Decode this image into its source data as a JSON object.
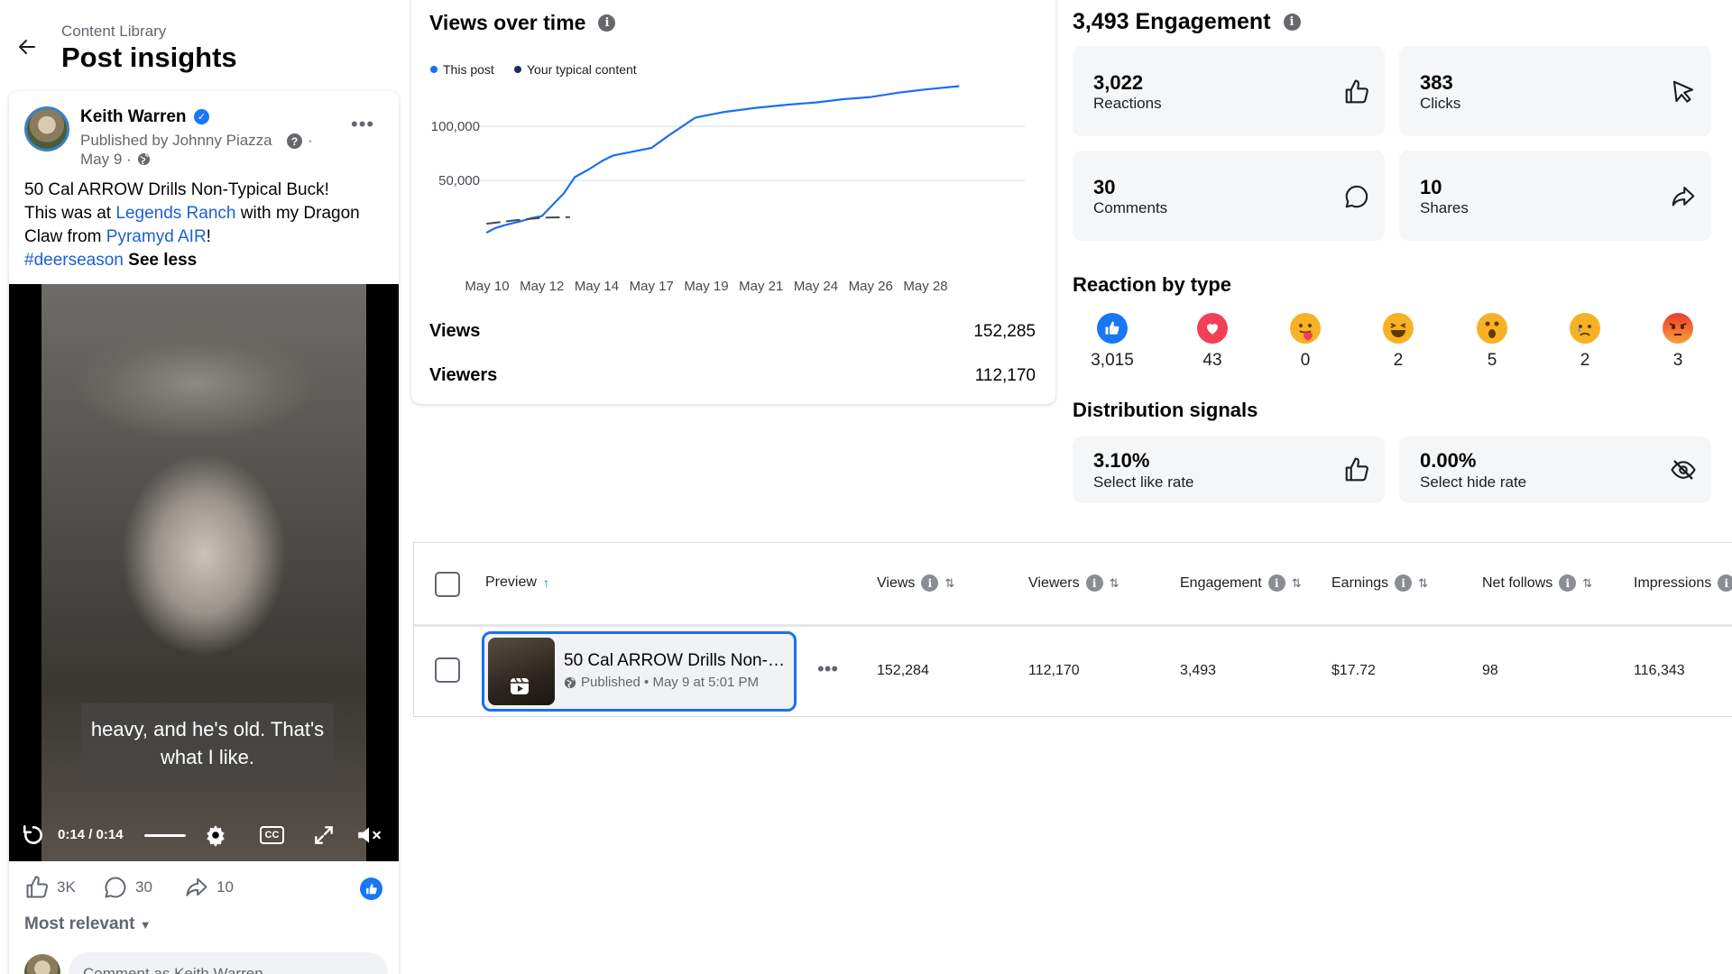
{
  "header": {
    "breadcrumb": "Content Library",
    "title": "Post insights"
  },
  "post": {
    "author": "Keith Warren",
    "published_by": "Published by Johnny Piazza",
    "date": "May 9 ·",
    "text_line1": "50 Cal ARROW Drills Non-Typical Buck!",
    "text_prefix": "This was at ",
    "link1": "Legends Ranch",
    "text_mid": " with my Dragon Claw from ",
    "link2": "Pyramyd AIR",
    "text_after": "!",
    "hashtag": "#deerseason",
    "see_less": "See less",
    "video": {
      "subtitle": "heavy, and he's old. That's what I like.",
      "time": "0:14 / 0:14",
      "cc_label": "CC"
    },
    "actions": {
      "likes": "3K",
      "comments": "30",
      "shares": "10"
    },
    "sort_label": "Most relevant",
    "comment_placeholder": "Comment as Keith Warren"
  },
  "views_chart": {
    "title": "Views over time",
    "legend_this": "This post",
    "legend_typical": "Your typical content",
    "views_label": "Views",
    "views_value": "152,285",
    "viewers_label": "Viewers",
    "viewers_value": "112,170",
    "colors": {
      "this_post": "#1b6ff2",
      "typical": "#1c2b5a"
    }
  },
  "chart_data": {
    "type": "line",
    "categories": [
      "May 10",
      "May 12",
      "May 14",
      "May 17",
      "May 19",
      "May 21",
      "May 24",
      "May 26",
      "May 28"
    ],
    "y_ticks": [
      "50,000",
      "100,000"
    ],
    "ylim": [
      0,
      150000
    ],
    "series": [
      {
        "name": "This post",
        "x": [
          0,
          0.15,
          0.35,
          0.6,
          0.8,
          1.0,
          1.15,
          1.4,
          1.6,
          1.85,
          2.1,
          2.3,
          2.6,
          3.0,
          3.3,
          3.8,
          4.3,
          4.9,
          5.5,
          6.0,
          6.5,
          7.0,
          7.5,
          8.0,
          8.6
        ],
        "values": [
          2000,
          6000,
          9000,
          12000,
          15000,
          17000,
          25000,
          38000,
          53000,
          60000,
          68000,
          73000,
          76000,
          80000,
          91000,
          108000,
          113000,
          117000,
          120000,
          122000,
          125000,
          127000,
          131000,
          134000,
          137000
        ]
      },
      {
        "name": "Your typical content",
        "x": [
          0,
          0.5,
          1.0,
          1.5
        ],
        "values": [
          10000,
          13000,
          15500,
          16000
        ]
      }
    ]
  },
  "engagement": {
    "title": "3,493 Engagement",
    "cards": [
      {
        "value": "3,022",
        "label": "Reactions",
        "icon": "thumbs-up-icon"
      },
      {
        "value": "383",
        "label": "Clicks",
        "icon": "cursor-icon"
      },
      {
        "value": "30",
        "label": "Comments",
        "icon": "comment-icon"
      },
      {
        "value": "10",
        "label": "Shares",
        "icon": "share-icon"
      }
    ]
  },
  "reactions": {
    "title": "Reaction by type",
    "items": [
      {
        "type": "like",
        "count": "3,015",
        "color": "#1877f2"
      },
      {
        "type": "love",
        "count": "43",
        "color": "#f33e58"
      },
      {
        "type": "care",
        "count": "0",
        "color": "#f7b125"
      },
      {
        "type": "haha",
        "count": "2",
        "color": "#f7b125"
      },
      {
        "type": "wow",
        "count": "5",
        "color": "#f7b125"
      },
      {
        "type": "sad",
        "count": "2",
        "color": "#f7b125"
      },
      {
        "type": "angry",
        "count": "3",
        "color": "#e9710f"
      }
    ]
  },
  "distribution": {
    "title": "Distribution signals",
    "cards": [
      {
        "value": "3.10%",
        "label": "Select like rate",
        "icon": "thumbs-up-icon"
      },
      {
        "value": "0.00%",
        "label": "Select hide rate",
        "icon": "eye-off-icon"
      }
    ]
  },
  "table": {
    "headers": [
      "Preview",
      "Views",
      "Viewers",
      "Engagement",
      "Earnings",
      "Net follows",
      "Impressions"
    ],
    "row": {
      "title": "50 Cal ARROW Drills Non-T...",
      "meta": "Published • May 9 at 5:01 PM",
      "views": "152,284",
      "viewers": "112,170",
      "engagement": "3,493",
      "earnings": "$17.72",
      "net_follows": "98",
      "impressions": "116,343"
    }
  }
}
